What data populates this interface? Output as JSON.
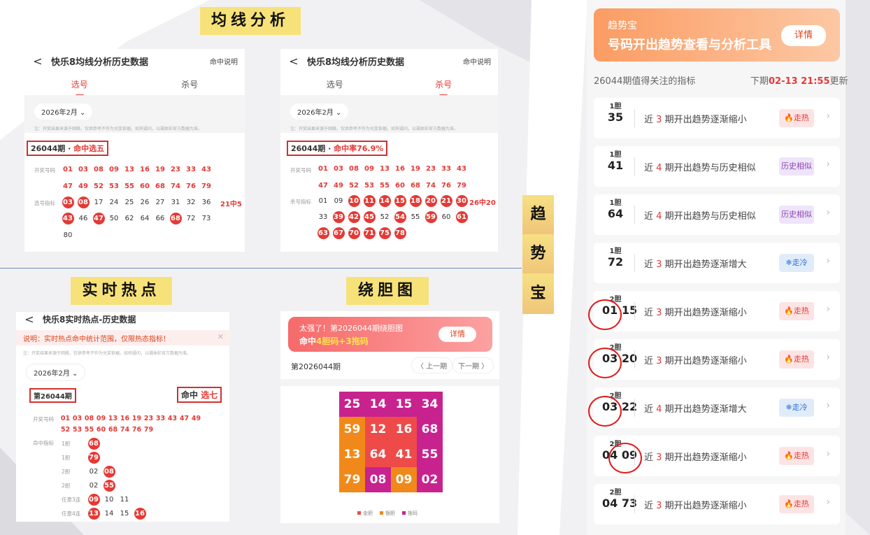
{
  "labels": {
    "junxian": "均线分析",
    "shishi": "实时热点",
    "raodan": "绕胆图",
    "side": [
      "趋",
      "势",
      "宝"
    ]
  },
  "panel1": {
    "back": "<",
    "title": "快乐8均线分析历史数据",
    "help": "命中说明",
    "tabs": [
      "选号",
      "杀号"
    ],
    "month": "2026年2月 ⌄",
    "disclaimer": "注：开奖结果来源于网络，仅供参考不作为兑奖依据。如有疑问，以福体彩官方数据为准。",
    "issue_prefix": "26044期 · ",
    "issue_hit": "命中选五",
    "draw_label": "开奖号码",
    "draw_row1": [
      "01",
      "03",
      "08",
      "09",
      "13",
      "16",
      "19",
      "23",
      "33",
      "43"
    ],
    "draw_row2": [
      "47",
      "49",
      "52",
      "53",
      "55",
      "60",
      "68",
      "74",
      "76",
      "79"
    ],
    "pick_label": "选号指标",
    "pick_row1": [
      "03",
      "08",
      "17",
      "24",
      "25",
      "26",
      "27",
      "31",
      "32",
      "36"
    ],
    "pick_row2": [
      "43",
      "46",
      "47",
      "50",
      "62",
      "64",
      "66",
      "68",
      "72",
      "73"
    ],
    "pick_row3": [
      "80"
    ],
    "pick_tail": "21中5"
  },
  "panel2": {
    "back": "<",
    "title": "快乐8均线分析历史数据",
    "help": "命中说明",
    "tabs": [
      "选号",
      "杀号"
    ],
    "month": "2026年2月 ⌄",
    "disclaimer": "注：开奖结果来源于网络，仅供参考不作为兑奖依据。如有疑问，以福体彩官方数据为准。",
    "issue_prefix": "26044期 · ",
    "issue_hit": "命中率76.9%",
    "draw_label": "开奖号码",
    "draw_row1": [
      "01",
      "03",
      "08",
      "09",
      "13",
      "16",
      "19",
      "23",
      "33",
      "43"
    ],
    "draw_row2": [
      "47",
      "49",
      "52",
      "53",
      "55",
      "60",
      "68",
      "74",
      "76",
      "79"
    ],
    "kill_label": "杀号指标",
    "kill_row1": [
      "01",
      "09",
      "10",
      "11",
      "14",
      "15",
      "18",
      "20",
      "21",
      "30"
    ],
    "kill_row2": [
      "33",
      "39",
      "42",
      "45",
      "52",
      "54",
      "55",
      "59",
      "60",
      "61"
    ],
    "kill_row3": [
      "63",
      "67",
      "70",
      "71",
      "75",
      "78"
    ],
    "kill_tail": "26中20"
  },
  "panel3": {
    "back": "<",
    "title": "快乐8实时热点-历史数据",
    "notice": "说明：实时热点命中统计范围，仅限热态指标！",
    "close": "✕",
    "disclaimer": "注：开奖结果来源于网络，仅供参考不作为兑奖依据。如有疑问，以福体彩官方数据为准。",
    "month": "2026年2月 ⌄",
    "issue": "第26044期",
    "hit_prefix": "命中 ",
    "hit_value": "选七",
    "draw_label": "开奖号码",
    "draw_row1": [
      "01",
      "03",
      "08",
      "09",
      "13",
      "16",
      "19",
      "23",
      "33",
      "43",
      "47",
      "49"
    ],
    "draw_row2": [
      "52",
      "53",
      "55",
      "60",
      "68",
      "74",
      "76",
      "79"
    ],
    "index_label": "命中指标",
    "rows": [
      {
        "label": "1胆",
        "nums": [
          "68"
        ],
        "hit": [
          true
        ]
      },
      {
        "label": "1胆",
        "nums": [
          "79"
        ],
        "hit": [
          true
        ]
      },
      {
        "label": "2胆",
        "nums": [
          "02",
          "08"
        ],
        "hit": [
          false,
          true
        ]
      },
      {
        "label": "2胆",
        "nums": [
          "02",
          "55"
        ],
        "hit": [
          false,
          true
        ]
      },
      {
        "label": "任意3连",
        "nums": [
          "09",
          "10",
          "11"
        ],
        "hit": [
          true,
          false,
          false
        ]
      },
      {
        "label": "任意4连",
        "nums": [
          "13",
          "14",
          "15",
          "16"
        ],
        "hit": [
          true,
          false,
          false,
          true
        ]
      }
    ]
  },
  "panel4": {
    "banner_line1": "太强了！第2026044期绕胆图",
    "banner_line2_prefix": "命中",
    "banner_line2_hl": "4胆码+3拖码",
    "detail": "详情",
    "issue": "第2026044期",
    "prev": "〈 上一期",
    "next": "下一期 〉",
    "grid": [
      [
        "25",
        "14",
        "15",
        "34"
      ],
      [
        "59",
        "12",
        "16",
        "68"
      ],
      [
        "13",
        "64",
        "41",
        "55"
      ],
      [
        "79",
        "08",
        "09",
        "02"
      ]
    ],
    "grid_colors": [
      [
        "#c8228e",
        "#c8228e",
        "#c8228e",
        "#c8228e"
      ],
      [
        "#f0891a",
        "#ee4a4a",
        "#ee4a4a",
        "#c8228e"
      ],
      [
        "#f0891a",
        "#ee4a4a",
        "#ee4a4a",
        "#c8228e"
      ],
      [
        "#f0891a",
        "#c8228e",
        "#f0891a",
        "#c8228e"
      ]
    ],
    "legend": [
      "金胆",
      "银胆",
      "拖码"
    ],
    "legend_colors": [
      "#ee4a4a",
      "#f0891a",
      "#c8228e"
    ]
  },
  "qsb": {
    "banner_title": "趋势宝",
    "banner_sub": "号码开出趋势查看与分析工具",
    "detail": "详情",
    "header_left": "26044期值得关注的指标",
    "header_right_prefix": "下期",
    "header_right_time": "02-13 21:55",
    "header_right_suffix": "更新",
    "cards": [
      {
        "type": "1胆",
        "nums": "35",
        "pre": "近",
        "k": "3",
        "post": "期开出趋势逐渐缩小",
        "badge": "🔥走热",
        "badge_class": "hot"
      },
      {
        "type": "1胆",
        "nums": "41",
        "pre": "近",
        "k": "4",
        "post": "期开出趋势与历史相似",
        "badge": "历史相似",
        "badge_class": "sim"
      },
      {
        "type": "1胆",
        "nums": "64",
        "pre": "近",
        "k": "4",
        "post": "期开出趋势与历史相似",
        "badge": "历史相似",
        "badge_class": "sim"
      },
      {
        "type": "1胆",
        "nums": "72",
        "pre": "近",
        "k": "3",
        "post": "期开出趋势逐渐增大",
        "badge": "❄走冷",
        "badge_class": "cold"
      },
      {
        "type": "2胆",
        "nums": "01 15",
        "pre": "近",
        "k": "3",
        "post": "期开出趋势逐渐缩小",
        "badge": "🔥走热",
        "badge_class": "hot"
      },
      {
        "type": "2胆",
        "nums": "03 20",
        "pre": "近",
        "k": "3",
        "post": "期开出趋势逐渐缩小",
        "badge": "🔥走热",
        "badge_class": "hot"
      },
      {
        "type": "2胆",
        "nums": "03 22",
        "pre": "近",
        "k": "4",
        "post": "期开出趋势逐渐增大",
        "badge": "❄走冷",
        "badge_class": "cold"
      },
      {
        "type": "2胆",
        "nums": "04 09",
        "pre": "近",
        "k": "3",
        "post": "期开出趋势逐渐缩小",
        "badge": "🔥走热",
        "badge_class": "hot"
      },
      {
        "type": "2胆",
        "nums": "04 73",
        "pre": "近",
        "k": "3",
        "post": "期开出趋势逐渐缩小",
        "badge": "🔥走热",
        "badge_class": "hot"
      }
    ],
    "arrow": "›"
  }
}
